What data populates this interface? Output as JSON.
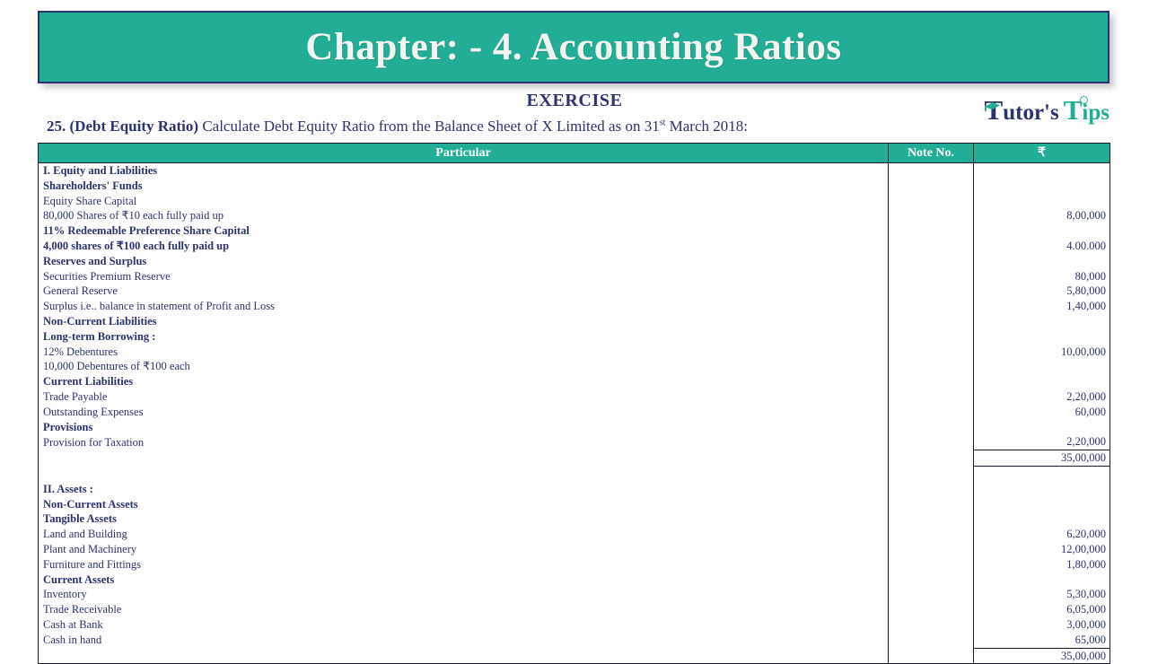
{
  "banner": {
    "title": "Chapter: - 4. Accounting Ratios"
  },
  "exercise_heading": "EXERCISE",
  "logo": {
    "part1_initial": "T",
    "part1_rest": "utor's",
    "part2_initial": "T",
    "part2_rest": "ips",
    "cap_icon": "graduation-cap-icon",
    "color_dark": "#2b3270",
    "color_teal": "#22ae96"
  },
  "question": {
    "number": "25.",
    "topic": "(Debt Equity Ratio)",
    "text_before_sup": " Calculate Debt Equity Ratio from the Balance Sheet of X Limited as on 31",
    "superscript": "st",
    "text_after_sup": " March 2018:"
  },
  "colors": {
    "accent_teal": "#22ae96",
    "text_navy": "#2b3270",
    "border": "#1a1a2e"
  },
  "table": {
    "headers": {
      "particular": "Particular",
      "note_no": "Note No.",
      "amount": "₹"
    },
    "rows": [
      {
        "label": "I. Equity and Liabilities",
        "level": 0,
        "note": "",
        "amount": "",
        "rule": "none"
      },
      {
        "label": "Shareholders' Funds",
        "level": 1,
        "note": "",
        "amount": "",
        "rule": "none"
      },
      {
        "label": "Equity Share Capital",
        "level": 2,
        "note": "",
        "amount": "",
        "rule": "none"
      },
      {
        "label": "80,000 Shares of ₹10 each fully paid up",
        "level": 2,
        "note": "",
        "amount": "8,00,000",
        "rule": "none"
      },
      {
        "label": "11% Redeemable Preference Share Capital",
        "level": 1,
        "note": "",
        "amount": "",
        "rule": "none"
      },
      {
        "label": "4,000 shares of ₹100 each fully paid up",
        "level": 1,
        "note": "",
        "amount": "4.00.000",
        "rule": "none"
      },
      {
        "label": "Reserves and Surplus",
        "level": 1,
        "note": "",
        "amount": "",
        "rule": "none"
      },
      {
        "label": "Securities Premium Reserve",
        "level": 2,
        "note": "",
        "amount": "80,000",
        "rule": "none"
      },
      {
        "label": "General Reserve",
        "level": 2,
        "note": "",
        "amount": "5,80,000",
        "rule": "none"
      },
      {
        "label": "Surplus i.e.. balance in statement of Profit and Loss",
        "level": 2,
        "note": "",
        "amount": "1,40,000",
        "rule": "none"
      },
      {
        "label": "Non-Current Liabilities",
        "level": 1,
        "note": "",
        "amount": "",
        "rule": "none"
      },
      {
        "label": "Long-term Borrowing :",
        "level": 1,
        "note": "",
        "amount": "",
        "rule": "none"
      },
      {
        "label": "12% Debentures",
        "level": 2,
        "note": "",
        "amount": "10,00,000",
        "rule": "none"
      },
      {
        "label": "10,000 Debentures of ₹100 each",
        "level": 2,
        "note": "",
        "amount": "",
        "rule": "none"
      },
      {
        "label": "Current Liabilities",
        "level": 1,
        "note": "",
        "amount": "",
        "rule": "none"
      },
      {
        "label": "Trade Payable",
        "level": 2,
        "note": "",
        "amount": "2,20,000",
        "rule": "none"
      },
      {
        "label": "Outstanding Expenses",
        "level": 2,
        "note": "",
        "amount": "60,000",
        "rule": "none"
      },
      {
        "label": "Provisions",
        "level": 1,
        "note": "",
        "amount": "",
        "rule": "none"
      },
      {
        "label": "Provision for Taxation",
        "level": 2,
        "note": "",
        "amount": "2,20,000",
        "rule": "none"
      },
      {
        "label": "",
        "level": 2,
        "note": "",
        "amount": "35,00,000",
        "rule": "total"
      },
      {
        "label": "",
        "level": 2,
        "note": "",
        "amount": "",
        "rule": "none"
      },
      {
        "label": "II. Assets :",
        "level": 0,
        "note": "",
        "amount": "",
        "rule": "none"
      },
      {
        "label": "Non-Current Assets",
        "level": 1,
        "note": "",
        "amount": "",
        "rule": "none"
      },
      {
        "label": "Tangible Assets",
        "level": 1,
        "note": "",
        "amount": "",
        "rule": "none"
      },
      {
        "label": "Land and Building",
        "level": 2,
        "note": "",
        "amount": "6,20,000",
        "rule": "none"
      },
      {
        "label": "Plant and Machinery",
        "level": 2,
        "note": "",
        "amount": "12,00,000",
        "rule": "none"
      },
      {
        "label": "Furniture and Fittings",
        "level": 2,
        "note": "",
        "amount": "1,80,000",
        "rule": "none"
      },
      {
        "label": "Current Assets",
        "level": 1,
        "note": "",
        "amount": "",
        "rule": "none"
      },
      {
        "label": "Inventory",
        "level": 2,
        "note": "",
        "amount": "5,30,000",
        "rule": "none"
      },
      {
        "label": "Trade Receivable",
        "level": 2,
        "note": "",
        "amount": "6,05,000",
        "rule": "none"
      },
      {
        "label": "Cash at Bank",
        "level": 2,
        "note": "",
        "amount": "3,00,000",
        "rule": "none"
      },
      {
        "label": "Cash in hand",
        "level": 2,
        "note": "",
        "amount": "65,000",
        "rule": "none"
      },
      {
        "label": "",
        "level": 2,
        "note": "",
        "amount": "35,00,000",
        "rule": "total"
      }
    ]
  }
}
